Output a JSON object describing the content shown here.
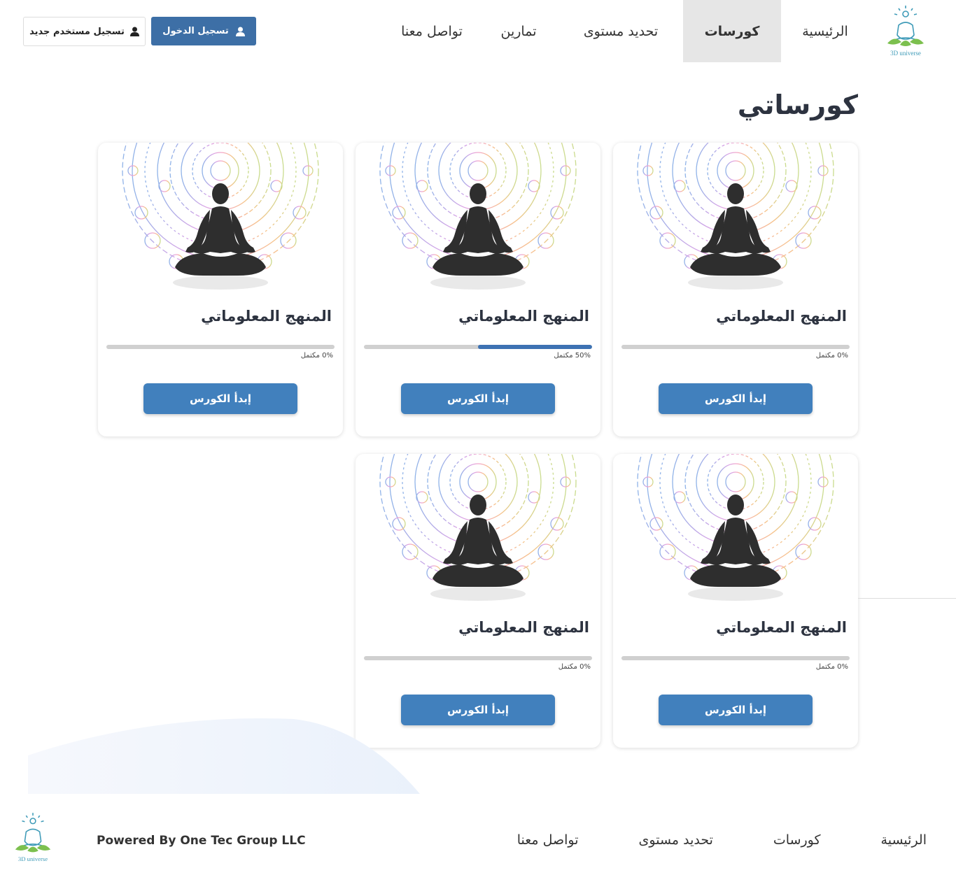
{
  "brand": {
    "logo_text": "3D universe"
  },
  "nav": {
    "items": [
      {
        "label": "الرئيسية",
        "active": false
      },
      {
        "label": "كورسات",
        "active": true
      },
      {
        "label": "تحديد مستوى",
        "active": false
      },
      {
        "label": "تمارين",
        "active": false
      },
      {
        "label": "تواصل معنا",
        "active": false
      }
    ]
  },
  "auth": {
    "login_label": "تسجيل الدخول",
    "register_label": "تسجيل مستخدم جديد",
    "icon": "user-icon"
  },
  "page": {
    "title": "كورساتي"
  },
  "courses": [
    {
      "title": "المنهج المعلوماتي",
      "progress": 0,
      "progress_label": "0% مكتمل",
      "button_label": "إبدأ الكورس"
    },
    {
      "title": "المنهج المعلوماتي",
      "progress": 50,
      "progress_label": "50% مكتمل",
      "button_label": "إبدأ الكورس"
    },
    {
      "title": "المنهج المعلوماتي",
      "progress": 0,
      "progress_label": "0% مكتمل",
      "button_label": "إبدأ الكورس"
    },
    {
      "title": "المنهج المعلوماتي",
      "progress": 0,
      "progress_label": "0% مكتمل",
      "button_label": "إبدأ الكورس"
    },
    {
      "title": "المنهج المعلوماتي",
      "progress": 0,
      "progress_label": "0% مكتمل",
      "button_label": "إبدأ الكورس"
    }
  ],
  "footer": {
    "links": [
      "الرئيسية",
      "كورسات",
      "تحديد مستوى",
      "تواصل معنا"
    ],
    "powered_by": "Powered By One Tec Group LLC"
  },
  "colors": {
    "primary": "#3d6fa6",
    "button": "#4180bd",
    "progress_fill": "#3d72b3",
    "active_nav_bg": "#e6e6e6"
  }
}
